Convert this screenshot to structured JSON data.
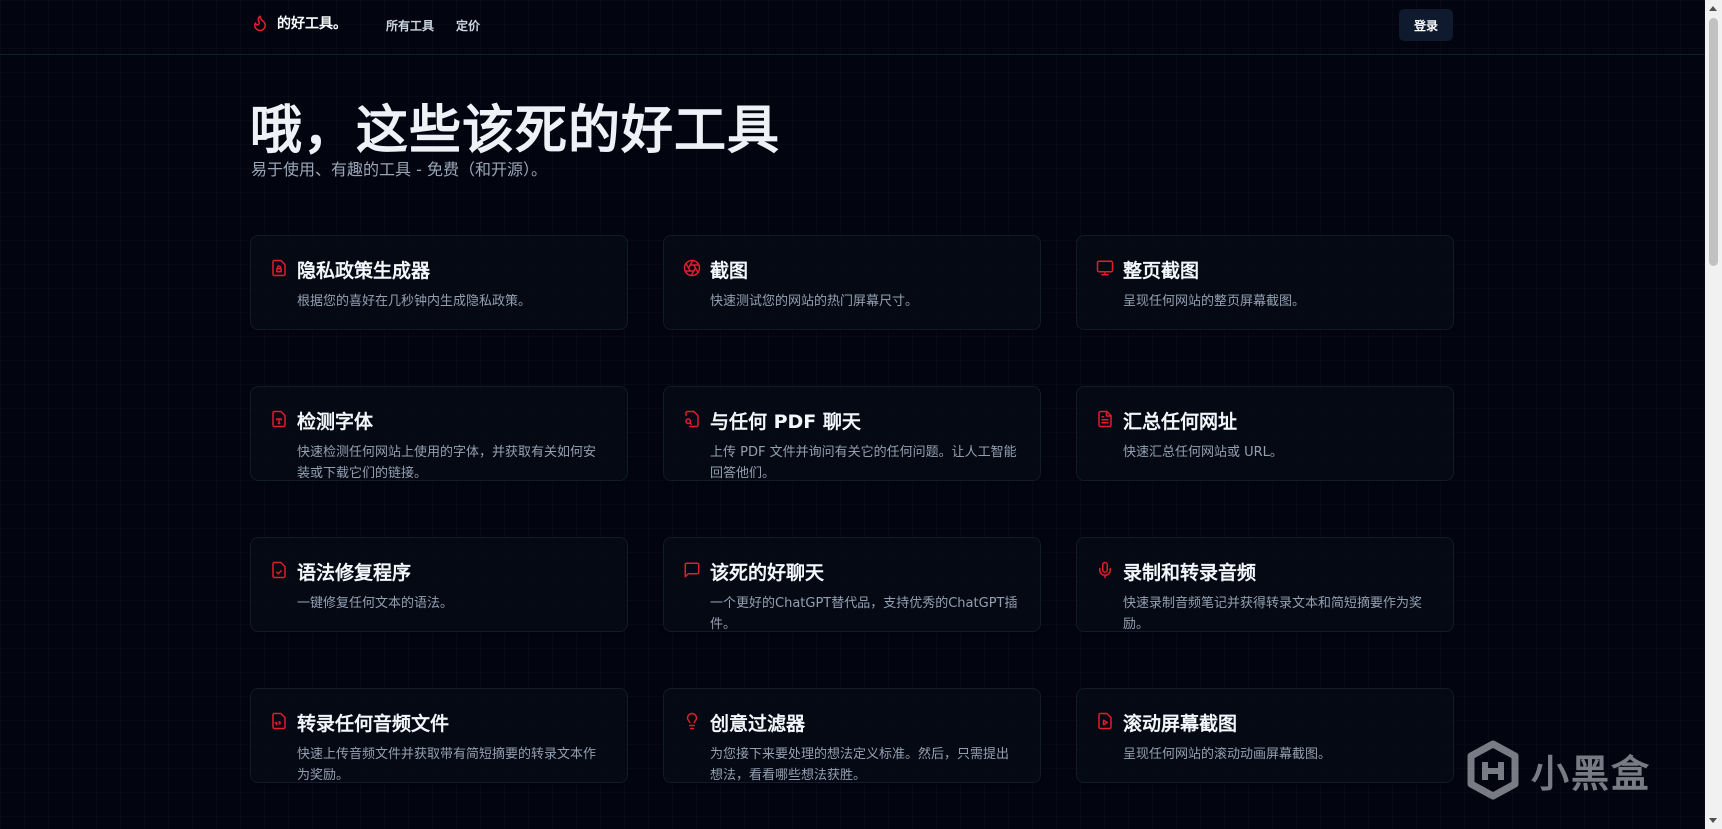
{
  "header": {
    "brand": "的好工具。",
    "nav": [
      "所有工具",
      "定价"
    ],
    "login_label": "登录"
  },
  "hero": {
    "title": "哦，这些该死的好工具",
    "subtitle": "易于使用、有趣的工具 - 免费（和开源）。"
  },
  "accent_color": "#e11d2e",
  "tools": [
    {
      "icon": "file-lock-icon",
      "title": "隐私政策生成器",
      "desc": "根据您的喜好在几秒钟内生成隐私政策。"
    },
    {
      "icon": "aperture-icon",
      "title": "截图",
      "desc": "快速测试您的网站的热门屏幕尺寸。"
    },
    {
      "icon": "monitor-icon",
      "title": "整页截图",
      "desc": "呈现任何网站的整页屏幕截图。"
    },
    {
      "icon": "file-type-icon",
      "title": "检测字体",
      "desc": "快速检测任何网站上使用的字体，并获取有关如何安装或下载它们的链接。"
    },
    {
      "icon": "file-search-icon",
      "title": "与任何 PDF 聊天",
      "desc": "上传 PDF 文件并询问有关它的任何问题。让人工智能回答他们。"
    },
    {
      "icon": "file-text-icon",
      "title": "汇总任何网址",
      "desc": "快速汇总任何网站或 URL。"
    },
    {
      "icon": "file-check-icon",
      "title": "语法修复程序",
      "desc": "一键修复任何文本的语法。"
    },
    {
      "icon": "message-square-icon",
      "title": "该死的好聊天",
      "desc": "一个更好的ChatGPT替代品，支持优秀的ChatGPT插件。"
    },
    {
      "icon": "microphone-icon",
      "title": "录制和转录音频",
      "desc": "快速录制音频笔记并获得转录文本和简短摘要作为奖励。"
    },
    {
      "icon": "file-audio-icon",
      "title": "转录任何音频文件",
      "desc": "快速上传音频文件并获取带有简短摘要的转录文本作为奖励。"
    },
    {
      "icon": "lightbulb-icon",
      "title": "创意过滤器",
      "desc": "为您接下来要处理的想法定义标准。然后，只需提出想法，看看哪些想法获胜。"
    },
    {
      "icon": "file-video-icon",
      "title": "滚动屏幕截图",
      "desc": "呈现任何网站的滚动动画屏幕截图。"
    }
  ],
  "watermark": "小黑盒"
}
